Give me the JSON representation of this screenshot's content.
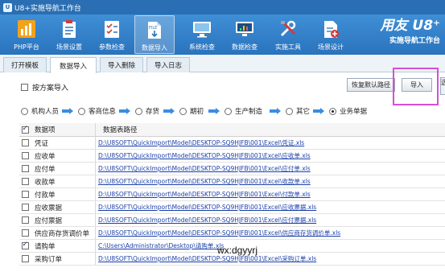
{
  "window": {
    "title": "U8+实施导航工作台"
  },
  "toolbar": {
    "items": [
      {
        "label": "PHP平台",
        "icon": "bar-chart-icon"
      },
      {
        "label": "场景设置",
        "icon": "clipboard-icon"
      },
      {
        "label": "参数检查",
        "icon": "checklist-icon"
      },
      {
        "label": "数据导入",
        "icon": "file-import-icon",
        "active": true
      },
      {
        "label": "系统检查",
        "icon": "monitor-icon"
      },
      {
        "label": "数据检查",
        "icon": "monitor-chart-icon"
      },
      {
        "label": "实施工具",
        "icon": "tools-icon"
      },
      {
        "label": "场景设计",
        "icon": "document-plus-icon"
      }
    ]
  },
  "brand": {
    "line1": "用友 U8⁺",
    "line2": "实施导航工作台"
  },
  "tabs": [
    {
      "label": "打开模板"
    },
    {
      "label": "数据导入",
      "active": true
    },
    {
      "label": "导入删除"
    },
    {
      "label": "导入日志"
    }
  ],
  "options": {
    "scheme_label": "按方案导入",
    "scheme_checked": false,
    "restore_button": "恢复默认路径",
    "import_button": "导入",
    "cut_button": "选"
  },
  "flow": [
    {
      "label": "机构人员",
      "selected": false
    },
    {
      "label": "客商信息",
      "selected": false
    },
    {
      "label": "存货",
      "selected": false
    },
    {
      "label": "期初",
      "selected": false
    },
    {
      "label": "生产制造",
      "selected": false
    },
    {
      "label": "其它",
      "selected": false
    },
    {
      "label": "业务单据",
      "selected": true
    }
  ],
  "table": {
    "header": {
      "name": "数据项",
      "path": "数据表路径",
      "checked": true
    },
    "rows": [
      {
        "name": "凭证",
        "checked": false,
        "path": "D:\\U8SOFT\\QuickImport\\Model\\DESKTOP-SQ9HJFB\\001\\Excel\\凭证.xls"
      },
      {
        "name": "应收单",
        "checked": false,
        "path": "D:\\U8SOFT\\QuickImport\\Model\\DESKTOP-SQ9HJFB\\001\\Excel\\应收单.xls"
      },
      {
        "name": "应付单",
        "checked": false,
        "path": "D:\\U8SOFT\\QuickImport\\Model\\DESKTOP-SQ9HJFB\\001\\Excel\\应付单.xls"
      },
      {
        "name": "收款单",
        "checked": false,
        "path": "D:\\U8SOFT\\QuickImport\\Model\\DESKTOP-SQ9HJFB\\001\\Excel\\收款单.xls"
      },
      {
        "name": "付款单",
        "checked": false,
        "path": "D:\\U8SOFT\\QuickImport\\Model\\DESKTOP-SQ9HJFB\\001\\Excel\\付款单.xls"
      },
      {
        "name": "应收票据",
        "checked": false,
        "path": "D:\\U8SOFT\\QuickImport\\Model\\DESKTOP-SQ9HJFB\\001\\Excel\\应收票据.xls"
      },
      {
        "name": "应付票据",
        "checked": false,
        "path": "D:\\U8SOFT\\QuickImport\\Model\\DESKTOP-SQ9HJFB\\001\\Excel\\应付票据.xls"
      },
      {
        "name": "供应商存货调价单",
        "checked": false,
        "path": "D:\\U8SOFT\\QuickImport\\Model\\DESKTOP-SQ9HJFB\\001\\Excel\\供应商存货调价单.xls"
      },
      {
        "name": "请购单",
        "checked": true,
        "path": "C:\\Users\\Administrator\\Desktop\\请购单.xls"
      },
      {
        "name": "采购订单",
        "checked": false,
        "path": "D:\\U8SOFT\\QuickImport\\Model\\DESKTOP-SQ9HJFB\\001\\Excel\\采购订单.xls"
      }
    ]
  },
  "watermark": "wx:dgyyrj",
  "colors": {
    "titlebar": "#2a6fb3",
    "toolbar": "#3f8fd6",
    "highlight": "#d64fd6",
    "link": "#1b3fa8",
    "arrow": "#3a8de0"
  }
}
